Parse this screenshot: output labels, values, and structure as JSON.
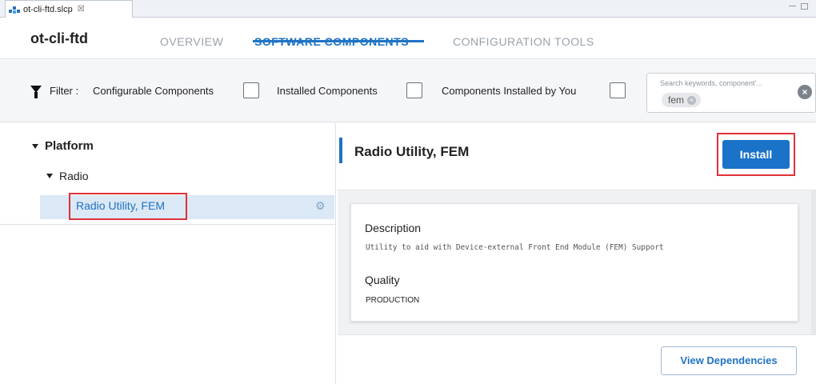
{
  "editor_tab": {
    "label": "ot-cli-ftd.slcp",
    "close": "☒"
  },
  "header": {
    "title": "ot-cli-ftd",
    "tabs": [
      {
        "label": "OVERVIEW",
        "active": false
      },
      {
        "label": "SOFTWARE COMPONENTS",
        "active": true
      },
      {
        "label": "CONFIGURATION TOOLS",
        "active": false
      }
    ]
  },
  "filter": {
    "prefix": "Filter :",
    "options": [
      {
        "label": "Configurable Components",
        "checked": false
      },
      {
        "label": "Installed Components",
        "checked": false
      },
      {
        "label": "Components Installed by You",
        "checked": false
      }
    ],
    "search_placeholder": "Search keywords, component'...",
    "search_chip": "fem"
  },
  "tree": {
    "category": "Platform",
    "subcategory": "Radio",
    "selected_item": "Radio Utility, FEM"
  },
  "detail": {
    "title": "Radio Utility, FEM",
    "install_label": "Install",
    "description_heading": "Description",
    "description": "Utility to aid with Device-external Front End Module (FEM) Support",
    "quality_heading": "Quality",
    "quality": "PRODUCTION",
    "view_dependencies_label": "View Dependencies"
  },
  "colors": {
    "accent": "#1f73c4",
    "install_button": "#1a73c9",
    "highlight_box": "#e0313a",
    "selected_row": "#dbe8f5"
  }
}
